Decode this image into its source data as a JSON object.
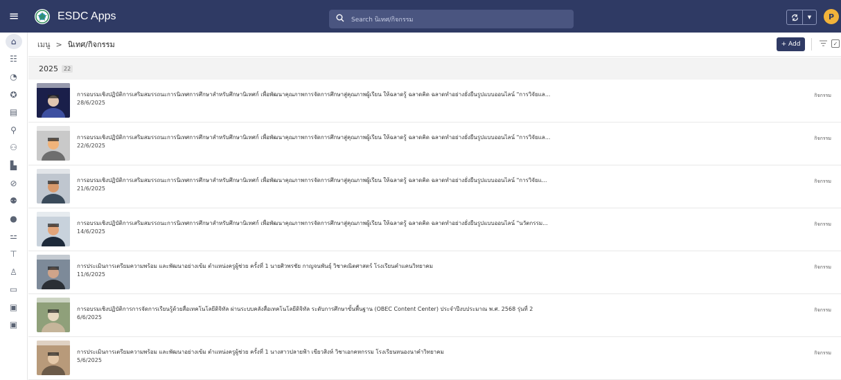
{
  "header": {
    "app_title": "ESDC Apps",
    "search_placeholder": "Search นิเทศ/กิจกรรม",
    "avatar_initial": "P",
    "brand_color": "#2f3a64"
  },
  "sidebar": {
    "items": [
      {
        "icon": "home-icon",
        "glyph": "⌂"
      },
      {
        "icon": "org-chart-icon",
        "glyph": "☷"
      },
      {
        "icon": "chart-icon",
        "glyph": "◔"
      },
      {
        "icon": "badge-icon",
        "glyph": "✪"
      },
      {
        "icon": "list-icon",
        "glyph": "▤"
      },
      {
        "icon": "location-icon",
        "glyph": "⚲"
      },
      {
        "icon": "users-icon",
        "glyph": "⚇"
      },
      {
        "icon": "teacher-icon",
        "glyph": "▙"
      },
      {
        "icon": "compass-icon",
        "glyph": "⊘"
      },
      {
        "icon": "group-icon",
        "glyph": "⚉"
      },
      {
        "icon": "person-icon",
        "glyph": "●"
      },
      {
        "icon": "person-network-icon",
        "glyph": "⚍"
      },
      {
        "icon": "hierarchy-icon",
        "glyph": "⊤"
      },
      {
        "icon": "family-icon",
        "glyph": "♙"
      },
      {
        "icon": "chat-icon",
        "glyph": "▭"
      },
      {
        "icon": "report-icon",
        "glyph": "▣"
      },
      {
        "icon": "report-2-icon",
        "glyph": "▣"
      }
    ]
  },
  "breadcrumb": {
    "root": "เมนู",
    "separator": ">",
    "current": "นิเทศ/กิจกรรม"
  },
  "toolbar": {
    "add_label": "+ Add"
  },
  "group": {
    "year": "2025",
    "count": "22"
  },
  "rows": [
    {
      "title": "การอบรมเชิงปฏิบัติการเสริมสมรรถนะการนิเทศการศึกษาสำหรับศึกษานิเทศก์ เพื่อพัฒนาคุณภาพการจัดการศึกษาสู่คุณภาพผู้เรียน ให้ฉลาดรู้ ฉลาดคิด ฉลาดทำอย่างยั่งยืนรูปแบบออนไลน์ \"การวิจัยแล...",
      "date": "28/6/2025",
      "tag": "กิจกรรม"
    },
    {
      "title": "การอบรมเชิงปฏิบัติการเสริมสมรรถนะการนิเทศการศึกษาสำหรับศึกษานิเทศก์ เพื่อพัฒนาคุณภาพการจัดการศึกษาสู่คุณภาพผู้เรียน ให้ฉลาดรู้ ฉลาดคิด ฉลาดทำอย่างยั่งยืนรูปแบบออนไลน์ \"การวิจัยแล...",
      "date": "22/6/2025",
      "tag": "กิจกรรม"
    },
    {
      "title": "การอบรมเชิงปฏิบัติการเสริมสมรรถนะการนิเทศการศึกษาสำหรับศึกษานิเทศก์ เพื่อพัฒนาคุณภาพการจัดการศึกษาสู่คุณภาพผู้เรียน ให้ฉลาดรู้ ฉลาดคิด ฉลาดทำอย่างยั่งยืนรูปแบบออนไลน์ \"การวิจัยแ...",
      "date": "21/6/2025",
      "tag": "กิจกรรม"
    },
    {
      "title": "การอบรมเชิงปฏิบัติการเสริมสมรรถนะการนิเทศการศึกษาสำหรับศึกษานิเทศก์ เพื่อพัฒนาคุณภาพการจัดการศึกษาสู่คุณภาพผู้เรียน ให้ฉลาดรู้ ฉลาดคิด ฉลาดทำอย่างยั่งยืนรูปแบบออนไลน์ \"นวัตกรรม...",
      "date": "14/6/2025",
      "tag": "กิจกรรม"
    },
    {
      "title": "การประเมินการเตรียมความพร้อม และพัฒนาอย่างเข้ม ตำแหน่งครูผู้ช่วย ครั้งที่ 1 นายศิวพรชัย กาญจนพันธุ์ วิชาคณิตศาสตร์ โรงเรียนคำแคนวิทยาคม",
      "date": "11/6/2025",
      "tag": "กิจกรรม"
    },
    {
      "title": "การอบรมเชิงปฏิบัติการการจัดการเรียนรู้ด้วยสื่อเทคโนโลยีดิจิทัล ผ่านระบบคลังสื่อเทคโนโลยีดิจิทัล ระดับการศึกษาขั้นพื้นฐาน (OBEC Content Center) ประจำปีงบประมาณ พ.ศ. 2568 รุ่นที่ 2",
      "date": "6/6/2025",
      "tag": "กิจกรรม"
    },
    {
      "title": "การประเมินการเตรียมความพร้อม และพัฒนาอย่างเข้ม ตำแหน่งครูผู้ช่วย ครั้งที่ 1 นางสาวปลายฟ้า เขียวสิงห์ วิชาเอกคหกรรม โรงเรียนหนองนาคำวิทยาคม",
      "date": "5/6/2025",
      "tag": "กิจกรรม"
    }
  ]
}
